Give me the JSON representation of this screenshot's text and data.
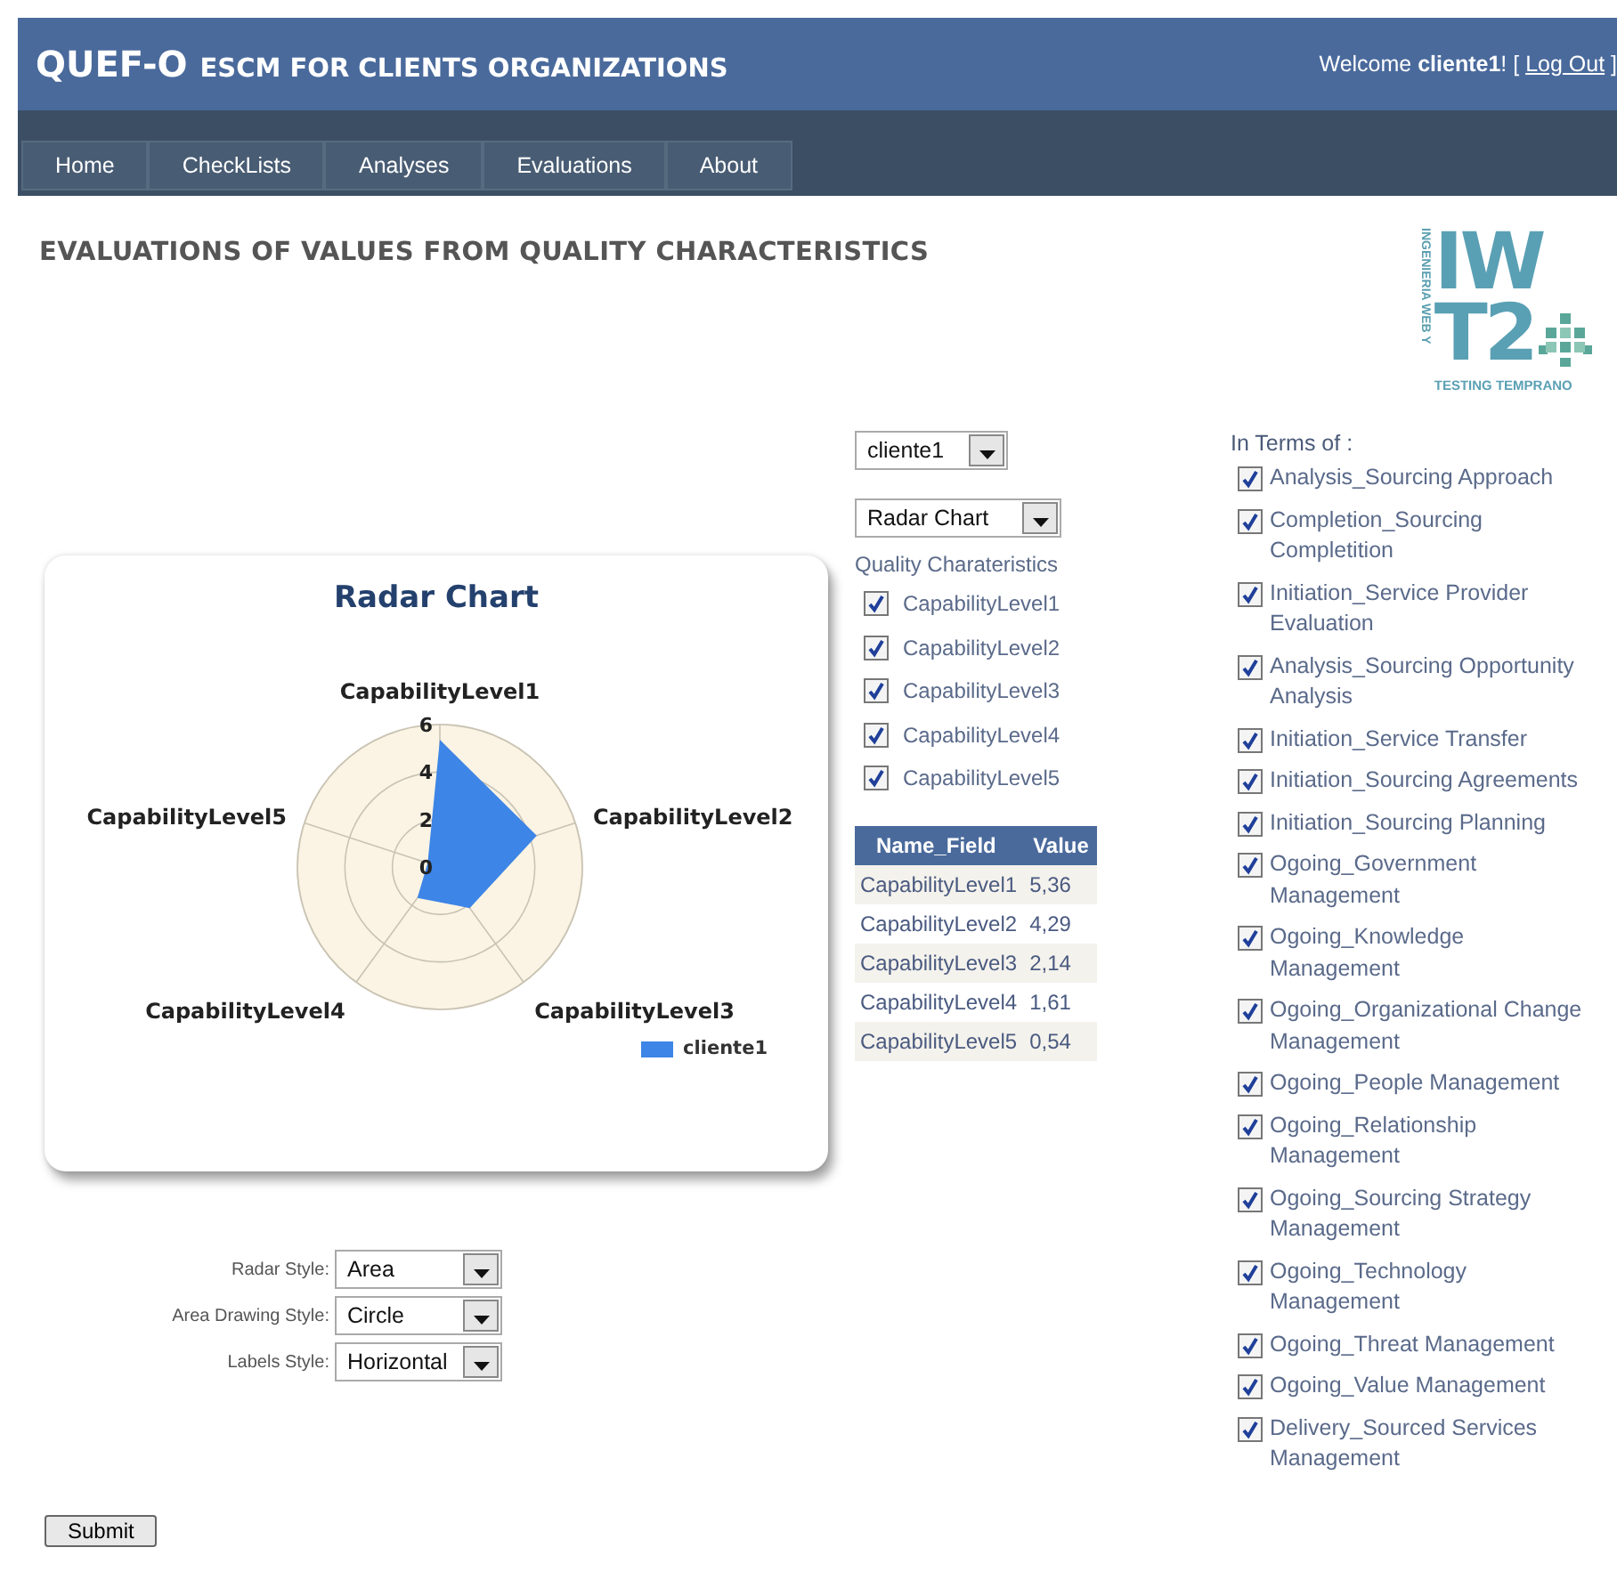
{
  "header": {
    "brand": "QUEF-O",
    "subtitle": "ESCM FOR CLIENTS ORGANIZATIONS",
    "welcome": {
      "text": "Welcome **cliente1**! [",
      "link": "Log Out",
      "after": "]"
    }
  },
  "nav": [
    {
      "label": "Home"
    },
    {
      "label": "CheckLists"
    },
    {
      "label": "Analyses"
    },
    {
      "label": "Evaluations"
    },
    {
      "label": "About"
    }
  ],
  "page_title": "EVALUATIONS OF VALUES FROM QUALITY CHARACTERISTICS",
  "logo": {
    "side": "INGENIERIA WEB Y",
    "mark_lines": [
      "IW",
      "T2"
    ],
    "tagline": "TESTING TEMPRANO"
  },
  "chart": {
    "title": "Radar Chart",
    "axis_labels": [
      "CapabilityLevel1",
      "CapabilityLevel5",
      "CapabilityLevel2",
      "CapabilityLevel4",
      "CapabilityLevel3"
    ],
    "ticks": [
      "6",
      "4",
      "2",
      "0"
    ],
    "series": {
      "name": "cliente1",
      "color": "#3d85e6"
    }
  },
  "style_options": [
    {
      "label": "Radar Style:",
      "value": "Area"
    },
    {
      "label": "Area Drawing Style:",
      "value": "Circle"
    },
    {
      "label": "Labels Style:",
      "value": "Horizontal"
    }
  ],
  "submit": "Submit",
  "client_select": "cliente1",
  "chart_type_select": "Radar Chart",
  "quality_label": "Quality Charateristics",
  "quality_items": [
    {
      "label": "CapabilityLevel1",
      "checked": true
    },
    {
      "label": "CapabilityLevel2",
      "checked": true
    },
    {
      "label": "CapabilityLevel3",
      "checked": true
    },
    {
      "label": "CapabilityLevel4",
      "checked": true
    },
    {
      "label": "CapabilityLevel5",
      "checked": true
    }
  ],
  "table": {
    "columns": [
      "Name_Field",
      "Value"
    ],
    "rows": [
      [
        "CapabilityLevel1",
        "5,36"
      ],
      [
        "CapabilityLevel2",
        "4,29"
      ],
      [
        "CapabilityLevel3",
        "2,14"
      ],
      [
        "CapabilityLevel4",
        "1,61"
      ],
      [
        "CapabilityLevel5",
        "0,54"
      ]
    ]
  },
  "terms_label": "In Terms of :",
  "terms": [
    {
      "label": "Analysis_Sourcing Approach",
      "checked": true
    },
    {
      "label": "Completion_Sourcing Completition",
      "checked": true
    },
    {
      "label": "Initiation_Service Provider Evaluation",
      "checked": true
    },
    {
      "label": "Analysis_Sourcing Opportunity Analysis",
      "checked": true
    },
    {
      "label": "Initiation_Service Transfer",
      "checked": true
    },
    {
      "label": "Initiation_Sourcing Agreements",
      "checked": true
    },
    {
      "label": "Initiation_Sourcing Planning",
      "checked": true
    },
    {
      "label": "Ogoing_Government Management",
      "checked": true
    },
    {
      "label": "Ogoing_Knowledge Management",
      "checked": true
    },
    {
      "label": "Ogoing_Organizational Change Management",
      "checked": true
    },
    {
      "label": "Ogoing_People Management",
      "checked": true
    },
    {
      "label": "Ogoing_Relationship Management",
      "checked": true
    },
    {
      "label": "Ogoing_Sourcing Strategy Management",
      "checked": true
    },
    {
      "label": "Ogoing_Technology Management",
      "checked": true
    },
    {
      "label": "Ogoing_Threat Management",
      "checked": true
    },
    {
      "label": "Ogoing_Value Management",
      "checked": true
    },
    {
      "label": "Delivery_Sourced Services Management",
      "checked": true
    }
  ]
}
